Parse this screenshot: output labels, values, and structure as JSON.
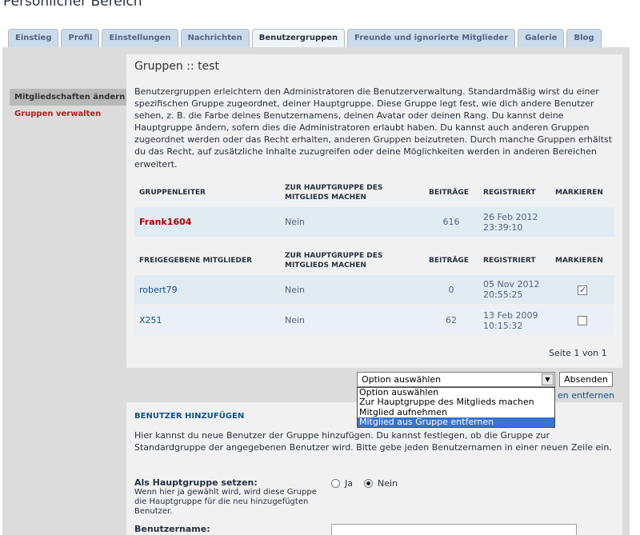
{
  "page": {
    "title": "Persönlicher Bereich"
  },
  "tabs": [
    {
      "label": "Einstieg",
      "active": false
    },
    {
      "label": "Profil",
      "active": false
    },
    {
      "label": "Einstellungen",
      "active": false
    },
    {
      "label": "Nachrichten",
      "active": false
    },
    {
      "label": "Benutzergruppen",
      "active": true
    },
    {
      "label": "Freunde und ignorierte Mitglieder",
      "active": false
    },
    {
      "label": "Galerie",
      "active": false
    },
    {
      "label": "Blog",
      "active": false
    }
  ],
  "sidebar": {
    "items": [
      {
        "label": "Mitgliedschaften ändern"
      },
      {
        "label": "Gruppen verwalten"
      }
    ]
  },
  "main": {
    "title": "Gruppen :: test",
    "intro": "Benutzergruppen erleichtern den Administratoren die Benutzerverwaltung. Standardmäßig wirst du einer spezifischen Gruppe zugeordnet, deiner Hauptgruppe. Diese Gruppe legt fest, wie dich andere Benutzer sehen, z. B. die Farbe deines Benutzernamens, deinen Avatar oder deinen Rang. Du kannst deine Hauptgruppe ändern, sofern dies die Administratoren erlaubt haben. Du kannst auch anderen Gruppen zugeordnet werden oder das Recht erhalten, anderen Gruppen beizutreten. Durch manche Gruppen erhältst du das Recht, auf zusätzliche Inhalte zuzugreifen oder deine Möglichkeiten werden in anderen Bereichen erweitert.",
    "leader_table": {
      "headers": [
        "GRUPPENLEITER",
        "ZUR HAUPTGRUPPE DES MITGLIEDS MACHEN",
        "BEITRÄGE",
        "REGISTRIERT",
        "MARKIEREN"
      ],
      "rows": [
        {
          "name": "Frank1604",
          "default": "Nein",
          "posts": "616",
          "registered": "26 Feb 2012 23:39:10"
        }
      ]
    },
    "member_table": {
      "headers": [
        "FREIGEGEBENE MITGLIEDER",
        "ZUR HAUPTGRUPPE DES MITGLIEDS MACHEN",
        "BEITRÄGE",
        "REGISTRIERT",
        "MARKIEREN"
      ],
      "rows": [
        {
          "name": "robert79",
          "default": "Nein",
          "posts": "0",
          "registered": "05 Nov 2012 20:55:25",
          "marked": true
        },
        {
          "name": "X251",
          "default": "Nein",
          "posts": "62",
          "registered": "13 Feb 2009 10:15:32",
          "marked": false
        }
      ]
    },
    "pager": "Seite 1 von 1",
    "action": {
      "selected": "Option auswählen",
      "submit_label": "Absenden",
      "hidden_link_tail": "en entfernen",
      "options": [
        "Option auswählen",
        "Zur Hauptgruppe des Mitglieds machen",
        "Mitglied aufnehmen",
        "Mitglied aus Gruppe entfernen"
      ],
      "highlighted_option": "Mitglied aus Gruppe entfernen"
    }
  },
  "add_users": {
    "heading": "BENUTZER HINZUFÜGEN",
    "intro": "Hier kannst du neue Benutzer der Gruppe hinzufügen. Du kannst festlegen, ob die Gruppe zur Standardgruppe der angegebenen Benutzer wird. Bitte gebe jeden Benutzernamen in einer neuen Zeile ein.",
    "default_label": "Als Hauptgruppe setzen:",
    "default_help": "Wenn hier ja gewählt wird, wird diese Gruppe die Hauptgruppe für die neu hinzugefügten Benutzer.",
    "radio_yes": "Ja",
    "radio_no": "Nein",
    "radio_selected": "Nein",
    "username_label": "Benutzername:"
  }
}
